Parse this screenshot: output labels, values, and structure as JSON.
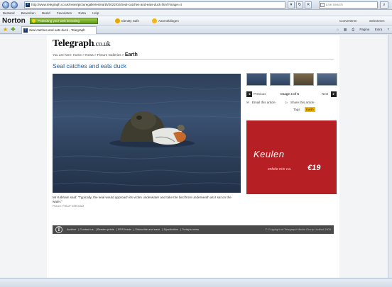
{
  "browser": {
    "url": "http://www.telegraph.co.uk/news/picturegalleries/earth/2022/02/Seal-catches-and-eats-duck.html?image=4",
    "menu": [
      "Bestand",
      "Bewerken",
      "Beeld",
      "Favorieten",
      "Extra",
      "Help"
    ],
    "search_placeholder": "Live Search",
    "tab_title": "Seal catches and eats duck - Telegraph",
    "tools": [
      "Pagina",
      "Extra"
    ]
  },
  "norton": {
    "logo": "Norton",
    "status": "Protecting your web browsing",
    "identity": "Identity Safe",
    "login": "Aanmeldingen",
    "convert": "Converteren",
    "select": "Selecteren"
  },
  "page": {
    "logo_main": "Telegraph",
    "logo_tld": ".co.uk",
    "breadcrumb_prefix": "You are here: Home > News > Picture Galleries >",
    "breadcrumb_current": "Earth",
    "headline": "Seal catches and eats duck",
    "caption": "Mr Kirkham said: \"Typically, the seal would approach its victim underwater and take the bird from underneath as it sat on the water.\"",
    "credit": "Picture: PHILIP KIRKHAM",
    "gallery": {
      "previous": "Previous",
      "position": "Image 4 of 6",
      "next": "Next"
    },
    "email_label": "Email this article",
    "share_label": "Share this article",
    "tag_label": "Tags",
    "tag_value": "Earth",
    "ad": {
      "city": "Keulen",
      "text": "enkele reis v.a.",
      "price": "€19"
    },
    "footer": {
      "links": [
        "Archive",
        "Contact us",
        "Reader prints",
        "RSS feeds",
        "Subscribe and save",
        "Syndication",
        "Today's news"
      ],
      "copyright": "© Copyright of Telegraph Media Group Limited 2009"
    }
  },
  "colors": {
    "headline": "#1f5c9c",
    "ad_bg": "#b61f23",
    "tag_bg": "#f5b800",
    "footer_bg": "#4a4a4a"
  }
}
